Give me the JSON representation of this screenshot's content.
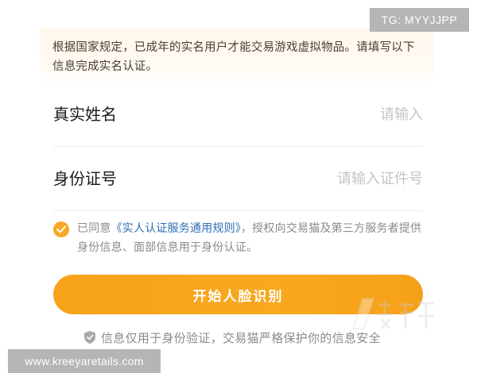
{
  "watermark": {
    "top_right": "TG: MYYJJPP",
    "bottom_left": "www.kreeyaretails.com"
  },
  "notice": "根据国家规定，已成年的实名用户才能交易游戏虚拟物品。请填写以下信息完成实名认证。",
  "form": {
    "name": {
      "label": "真实姓名",
      "placeholder": "请输入"
    },
    "id_number": {
      "label": "身份证号",
      "placeholder": "请输入证件号"
    }
  },
  "agreement": {
    "checked": true,
    "prefix": "已同意",
    "link": "《实人认证服务通用规则》",
    "suffix": "，授权向交易猫及第三方服务者提供身份信息、面部信息用于身份认证。"
  },
  "submit_label": "开始人脸识别",
  "security_note": "信息仅用于身份验证，交易猫严格保护你的信息安全",
  "colors": {
    "accent": "#f8a81f",
    "link": "#2f6fb3",
    "notice_bg": "#fff7ec"
  }
}
